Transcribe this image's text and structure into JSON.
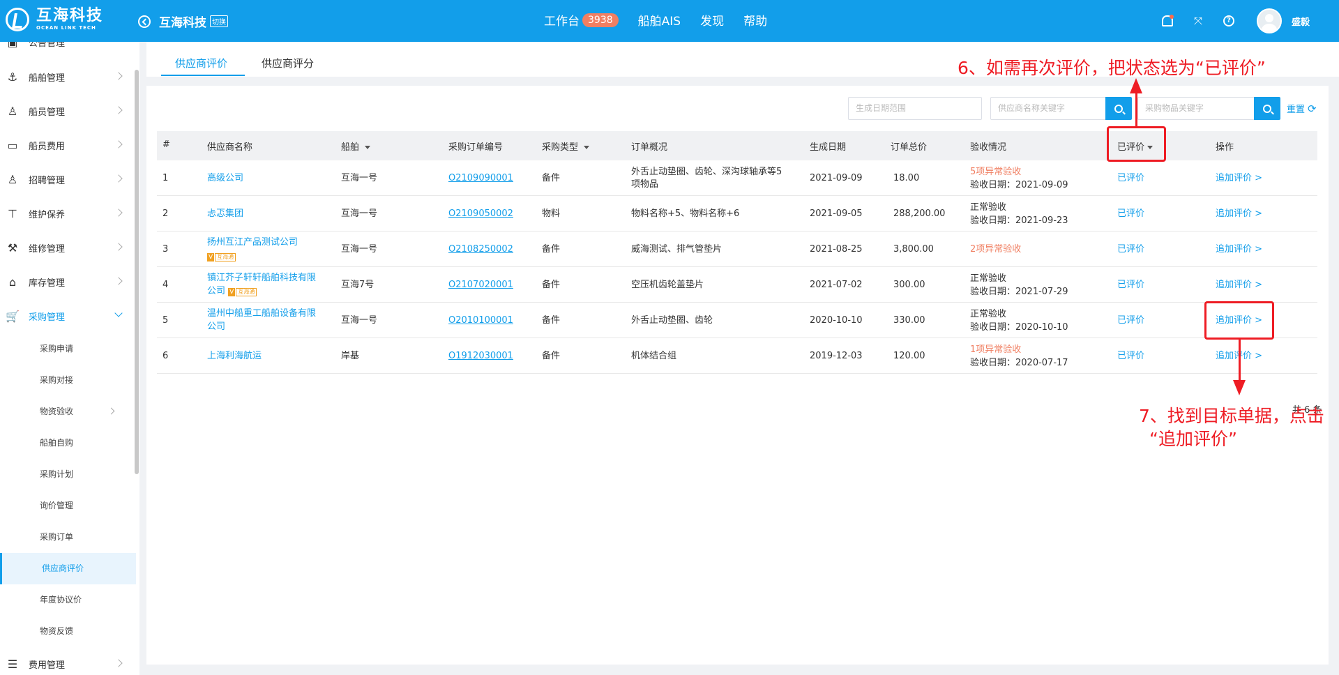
{
  "header": {
    "logo_cn": "互海科技",
    "logo_en": "OCEAN LINK TECH",
    "company": "互海科技",
    "switch_label": "切换",
    "nav": {
      "workbench": "工作台",
      "workbench_count": "3938",
      "ais": "船舶AIS",
      "discover": "发现",
      "help": "帮助"
    },
    "username": "盛毅"
  },
  "sidebar": {
    "partial_top": "公告管理",
    "items": [
      {
        "label": "船舶管理",
        "icon": "anchor-icon"
      },
      {
        "label": "船员管理",
        "icon": "person-icon"
      },
      {
        "label": "船员费用",
        "icon": "wallet-icon"
      },
      {
        "label": "招聘管理",
        "icon": "recruit-icon"
      },
      {
        "label": "维护保养",
        "icon": "hammer-icon"
      },
      {
        "label": "维修管理",
        "icon": "wrench-icon"
      },
      {
        "label": "库存管理",
        "icon": "warehouse-icon"
      },
      {
        "label": "采购管理",
        "icon": "cart-icon"
      }
    ],
    "sub_items": [
      "采购申请",
      "采购对接",
      "物资验收",
      "船舶自购",
      "采购计划",
      "询价管理",
      "采购订单",
      "供应商评价",
      "年度协议价",
      "物资反馈"
    ],
    "bottom_item": {
      "label": "费用管理",
      "icon": "coins-icon"
    }
  },
  "tabs": [
    "供应商评价",
    "供应商评分"
  ],
  "filters": {
    "date_placeholder": "生成日期范围",
    "supplier_placeholder": "供应商名称关键字",
    "goods_placeholder": "采购物品关键字",
    "reset": "重置"
  },
  "table": {
    "headers": [
      "#",
      "供应商名称",
      "船舶",
      "采购订单编号",
      "采购类型",
      "订单概况",
      "生成日期",
      "订单总价",
      "验收情况",
      "已评价",
      "操作"
    ],
    "rows": [
      {
        "no": "1",
        "supplier": "高级公司",
        "tag": false,
        "ship": "互海一号",
        "order": "O2109090001",
        "type": "备件",
        "summary1": "外舌止动垫圈、齿轮、深沟球轴承等5",
        "summary2": "项物品",
        "date": "2021-09-09",
        "price": "18.00",
        "acc1": "5项异常验收",
        "acc1_warn": true,
        "acc2": "验收日期：2021-09-09",
        "status": "已评价",
        "action": "追加评价 >"
      },
      {
        "no": "2",
        "supplier": "忐忑集团",
        "tag": false,
        "ship": "互海一号",
        "order": "O2109050002",
        "type": "物料",
        "summary1": "物料名称+5、物料名称+6",
        "summary2": "",
        "date": "2021-09-05",
        "price": "288,200.00",
        "acc1": "正常验收",
        "acc1_warn": false,
        "acc2": "验收日期：2021-09-23",
        "status": "已评价",
        "action": "追加评价 >"
      },
      {
        "no": "3",
        "supplier": "扬州互江产品测试公司",
        "tag": true,
        "ship": "互海一号",
        "order": "O2108250002",
        "type": "备件",
        "summary1": "威海测试、排气管垫片",
        "summary2": "",
        "date": "2021-08-25",
        "price": "3,800.00",
        "acc1": "2项异常验收",
        "acc1_warn": true,
        "acc2": "",
        "status": "已评价",
        "action": "追加评价 >"
      },
      {
        "no": "4",
        "supplier": "镇江芥子轩轩船舶科技有限",
        "supplier2": "公司",
        "tag": true,
        "ship": "互海7号",
        "order": "O2107020001",
        "type": "备件",
        "summary1": "空压机齿轮盖垫片",
        "summary2": "",
        "date": "2021-07-02",
        "price": "300.00",
        "acc1": "正常验收",
        "acc1_warn": false,
        "acc2": "验收日期：2021-07-29",
        "status": "已评价",
        "action": "追加评价 >"
      },
      {
        "no": "5",
        "supplier": "温州中船重工船舶设备有限",
        "supplier2": "公司",
        "tag": false,
        "ship": "互海一号",
        "order": "O2010100001",
        "type": "备件",
        "summary1": "外舌止动垫圈、齿轮",
        "summary2": "",
        "date": "2020-10-10",
        "price": "330.00",
        "acc1": "正常验收",
        "acc1_warn": false,
        "acc2": "验收日期：2020-10-10",
        "status": "已评价",
        "action": "追加评价 >"
      },
      {
        "no": "6",
        "supplier": "上海利海航运",
        "tag": false,
        "ship": "岸基",
        "order": "O1912030001",
        "type": "备件",
        "summary1": "机体结合组",
        "summary2": "",
        "date": "2019-12-03",
        "price": "120.00",
        "acc1": "1项异常验收",
        "acc1_warn": true,
        "acc2": "验收日期：2020-07-17",
        "status": "已评价",
        "action": "追加评价 >"
      }
    ],
    "tag_v": "V",
    "tag_name": "互海通",
    "total": "共 6 条"
  },
  "annotations": {
    "step6": "6、如需再次评价，把状态选为“已评价”",
    "step7_line1": "7、找到目标单据，点击",
    "step7_line2": "“追加评价”"
  },
  "colors": {
    "primary": "#129eea",
    "warn": "#f07f62",
    "annotation": "#ee1c24"
  }
}
